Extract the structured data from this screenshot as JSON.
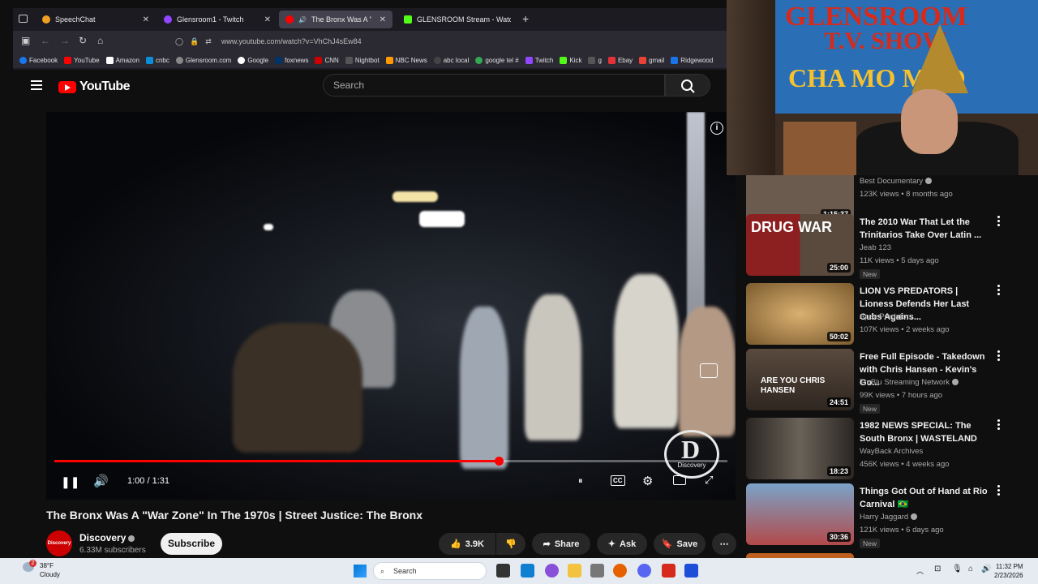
{
  "browser": {
    "tabs": [
      {
        "title": "SpeechChat",
        "color": "#f0a020",
        "active": false
      },
      {
        "title": "Glensroom1 - Twitch",
        "color": "#9146ff",
        "active": false
      },
      {
        "title": "The Bronx Was A \"War Zon",
        "color": "#ff0000",
        "active": true
      },
      {
        "title": "GLENSROOM Stream - Watch L",
        "color": "#53fc18",
        "active": false
      }
    ],
    "url": "www.youtube.com/watch?v=VhChJ4sEw84",
    "bookmarks": [
      "Facebook",
      "YouTube",
      "Amazon",
      "cnbc",
      "Glensroom.com",
      "Google",
      "foxnews",
      "CNN",
      "Nightbot",
      "NBC News",
      "abc local",
      "google tel #",
      "Twitch",
      "Kick",
      "g",
      "Ebay",
      "gmail",
      "Ridgewood"
    ]
  },
  "yt": {
    "logo_text": "YouTube",
    "search_placeholder": "Search"
  },
  "player": {
    "time": "1:00 / 1:31",
    "progress_fraction": 0.66,
    "watermark": "Discovery",
    "info_glyph": "i"
  },
  "video": {
    "title": "The Bronx Was A \"War Zone\" In The 1970s | Street Justice: The Bronx",
    "channel": "Discovery",
    "channel_avatar_text": "Discovery",
    "subscribers": "6.33M subscribers",
    "subscribe_label": "Subscribe",
    "likes": "3.9K",
    "share_label": "Share",
    "ask_label": "Ask",
    "save_label": "Save"
  },
  "webcam": {
    "banner_line1": "GLENSROOM",
    "banner_line2": "T.V. SHOW",
    "banner_line3": "CHA MO  MAO"
  },
  "recommendations": [
    {
      "title": "",
      "channel": "Best Documentary",
      "meta": "123K views • 8 months ago",
      "duration": "1:15:37",
      "new": false,
      "thumb": "#6b5a4e",
      "partial": true
    },
    {
      "title": "The 2010 War That Let the Trinitarios Take Over Latin ...",
      "channel": "Jeab 123",
      "meta": "11K views • 5 days ago",
      "duration": "25:00",
      "new": true,
      "thumb": "#8c1f1f",
      "thumb_text": "DRUG WAR"
    },
    {
      "title": "LION VS PREDATORS | Lioness Defends Her Last Cubs Agains...",
      "channel": "Apex Predators",
      "meta": "107K views • 2 weeks ago",
      "duration": "50:02",
      "new": false,
      "thumb": "#b48a4a"
    },
    {
      "title": "Free Full Episode - Takedown with Chris Hansen - Kevin's Go...",
      "channel": "TruBlu Streaming Network",
      "meta": "99K views • 7 hours ago",
      "duration": "24:51",
      "new": true,
      "thumb": "#4a4036",
      "thumb_text": "ARE YOU CHRIS HANSEN"
    },
    {
      "title": "1982 NEWS SPECIAL: The South Bronx | WASTELAND",
      "channel": "WayBack Archives",
      "meta": "456K views • 4 weeks ago",
      "duration": "18:23",
      "new": false,
      "thumb": "#3c3a36"
    },
    {
      "title": "Things Got Out of Hand at Rio Carnival 🇧🇷",
      "channel": "Harry Jaggard",
      "meta": "121K views • 6 days ago",
      "duration": "30:36",
      "new": true,
      "thumb": "#a64a4a"
    }
  ],
  "taskbar": {
    "temp": "38°F",
    "condition": "Cloudy",
    "badge": "2",
    "search_label": "Search",
    "time": "11:32 PM",
    "date": "2/23/2026"
  },
  "labels": {
    "new": "New"
  }
}
